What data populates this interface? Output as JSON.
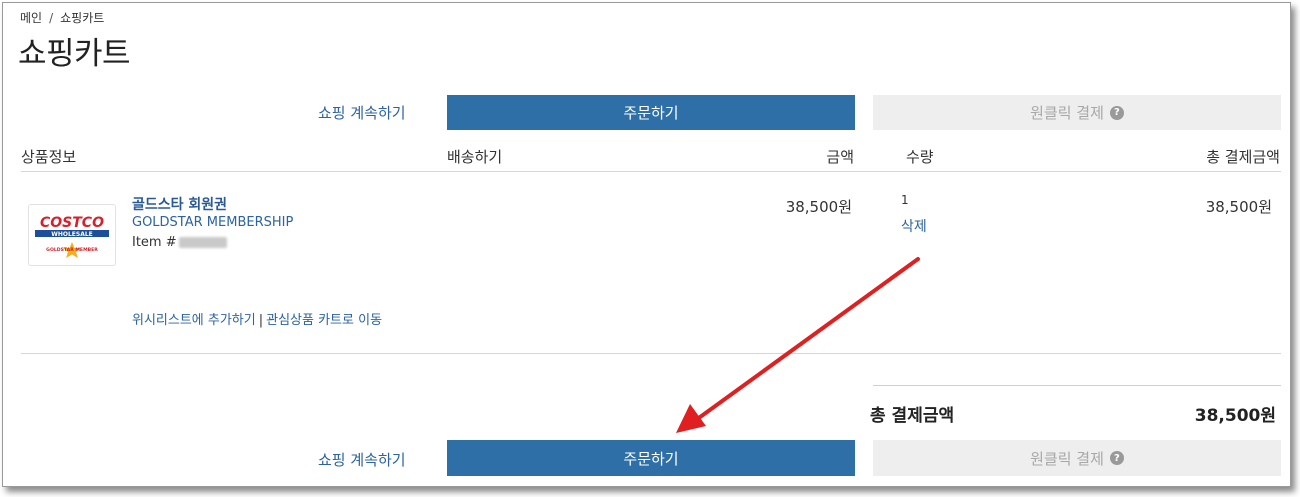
{
  "breadcrumb": {
    "home": "메인",
    "separator": "/",
    "current": "쇼핑카트"
  },
  "page_title": "쇼핑카트",
  "actions": {
    "continue_shopping": "쇼핑 계속하기",
    "order": "주문하기",
    "one_click_pay": "원클릭 결제",
    "help_glyph": "?"
  },
  "columns": {
    "product_info": "상품정보",
    "shipping": "배송하기",
    "amount": "금액",
    "quantity": "수량",
    "total_amount": "총 결제금액"
  },
  "cart_item": {
    "logo_text": "COSTCO",
    "logo_sub": "WHOLESALE",
    "logo_badge": "GOLDSTAR MEMBER",
    "name_ko": "골드스타 회원권",
    "name_en": "GOLDSTAR MEMBERSHIP",
    "item_prefix": "Item #",
    "price": "38,500원",
    "quantity": "1",
    "delete": "삭제",
    "line_total": "38,500원",
    "add_wishlist": "위시리스트에 추가하기",
    "link_separator": "|",
    "move_to_saved": "관심상품 카트로 이동"
  },
  "summary": {
    "total_label": "총 결제금액",
    "total_value": "38,500원"
  },
  "colors": {
    "primary_button": "#2f6fa8",
    "link": "#2c63a0",
    "disabled_button": "#eeeeee",
    "annotation_arrow": "#e02020"
  }
}
